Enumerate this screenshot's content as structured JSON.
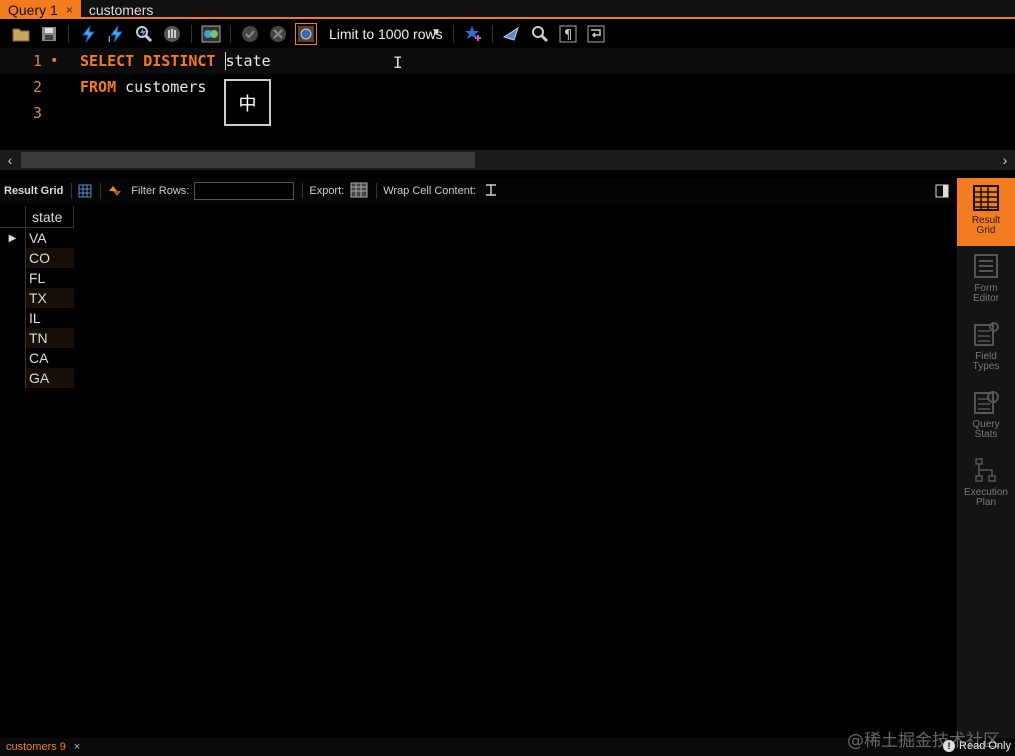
{
  "tabs": [
    {
      "label": "Query 1",
      "active": true,
      "close": "×"
    },
    {
      "label": "customers",
      "active": false
    }
  ],
  "toolbar": {
    "limit_label": "Limit to 1000 rows",
    "icons": [
      "folder-icon",
      "save-icon",
      "execute-icon",
      "execute-current-icon",
      "explain-icon",
      "stop-icon",
      "toggle-output-icon",
      "commit-icon",
      "rollback-icon",
      "autocommit-icon",
      "bookmark-icon",
      "beautify-icon",
      "find-icon",
      "invisible-chars-icon",
      "wrap-icon"
    ]
  },
  "editor": {
    "lines": [
      {
        "number": "1",
        "marker": "•",
        "keyword": "SELECT DISTINCT ",
        "text": "state"
      },
      {
        "number": "2",
        "keyword": "FROM ",
        "text": "customers"
      },
      {
        "number": "3",
        "keyword": "",
        "text": ""
      }
    ],
    "ime_char": "中",
    "ibeam": "I"
  },
  "result_toolbar": {
    "result_grid": "Result Grid",
    "filter_rows": "Filter Rows:",
    "export": "Export:",
    "wrap_cell": "Wrap Cell Content:"
  },
  "grid": {
    "column": "state",
    "row_marker": "▶",
    "rows": [
      "VA",
      "CO",
      "FL",
      "TX",
      "IL",
      "TN",
      "CA",
      "GA"
    ]
  },
  "side_panel": [
    {
      "line1": "Result",
      "line2": "Grid",
      "active": true
    },
    {
      "line1": "Form",
      "line2": "Editor",
      "active": false
    },
    {
      "line1": "Field",
      "line2": "Types",
      "active": false
    },
    {
      "line1": "Query",
      "line2": "Stats",
      "active": false
    },
    {
      "line1": "Execution",
      "line2": "Plan",
      "active": false
    }
  ],
  "status": {
    "tab": "customers 9",
    "close": "×",
    "readonly": "Read Only",
    "info": "!",
    "watermark": "@稀土掘金技术社区"
  },
  "colors": {
    "accent": "#f47c20",
    "background": "#000000"
  }
}
